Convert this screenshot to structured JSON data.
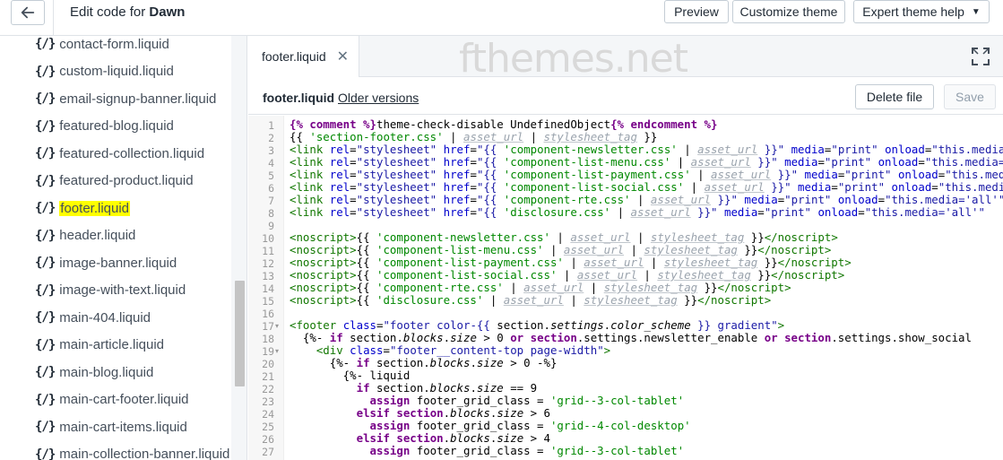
{
  "header": {
    "title_prefix": "Edit code for ",
    "theme_name": "Dawn",
    "preview_label": "Preview",
    "customize_label": "Customize theme",
    "expert_label": "Expert theme help"
  },
  "sidebar": {
    "icon_text": "{/}",
    "files": [
      "contact-form.liquid",
      "custom-liquid.liquid",
      "email-signup-banner.liquid",
      "featured-blog.liquid",
      "featured-collection.liquid",
      "featured-product.liquid",
      "footer.liquid",
      "header.liquid",
      "image-banner.liquid",
      "image-with-text.liquid",
      "main-404.liquid",
      "main-article.liquid",
      "main-blog.liquid",
      "main-cart-footer.liquid",
      "main-cart-items.liquid",
      "main-collection-banner.liquid"
    ],
    "active_index": 6
  },
  "editor": {
    "tab_label": "footer.liquid",
    "watermark": "fthemes.net",
    "file_name": "footer.liquid",
    "older_versions_label": "Older versions",
    "delete_label": "Delete file",
    "save_label": "Save",
    "line_numbers": [
      "1",
      "2",
      "3",
      "4",
      "5",
      "6",
      "7",
      "8",
      "9",
      "10",
      "11",
      "12",
      "13",
      "14",
      "15",
      "16",
      "17",
      "18",
      "19",
      "20",
      "21",
      "22",
      "23",
      "24",
      "25",
      "26",
      "27"
    ],
    "fold_lines": [
      17,
      19
    ],
    "code_lines": [
      [
        [
          "kw",
          "{% comment %}"
        ],
        [
          "t",
          "theme-check-disable UndefinedObject"
        ],
        [
          "kw",
          "{% endcomment %}"
        ]
      ],
      [
        [
          "t",
          "{{ "
        ],
        [
          "strg",
          "'section-footer.css'"
        ],
        [
          "t",
          " | "
        ],
        [
          "flt",
          "asset_url"
        ],
        [
          "t",
          " | "
        ],
        [
          "flt",
          "stylesheet_tag"
        ],
        [
          "t",
          " }}"
        ]
      ],
      [
        [
          "tag",
          "<link "
        ],
        [
          "attr",
          "rel"
        ],
        [
          "t",
          "="
        ],
        [
          "str",
          "\"stylesheet\""
        ],
        [
          "t",
          " "
        ],
        [
          "attr",
          "href"
        ],
        [
          "t",
          "="
        ],
        [
          "str",
          "\"{{ "
        ],
        [
          "strg",
          "'component-newsletter.css'"
        ],
        [
          "t",
          " | "
        ],
        [
          "flt",
          "asset_url"
        ],
        [
          "str",
          " }}\""
        ],
        [
          "t",
          " "
        ],
        [
          "attr",
          "media"
        ],
        [
          "t",
          "="
        ],
        [
          "str",
          "\"print\""
        ],
        [
          "t",
          " "
        ],
        [
          "attr",
          "onload"
        ],
        [
          "t",
          "="
        ],
        [
          "str",
          "\"this.media='all'\""
        ]
      ],
      [
        [
          "tag",
          "<link "
        ],
        [
          "attr",
          "rel"
        ],
        [
          "t",
          "="
        ],
        [
          "str",
          "\"stylesheet\""
        ],
        [
          "t",
          " "
        ],
        [
          "attr",
          "href"
        ],
        [
          "t",
          "="
        ],
        [
          "str",
          "\"{{ "
        ],
        [
          "strg",
          "'component-list-menu.css'"
        ],
        [
          "t",
          " | "
        ],
        [
          "flt",
          "asset_url"
        ],
        [
          "str",
          " }}\""
        ],
        [
          "t",
          " "
        ],
        [
          "attr",
          "media"
        ],
        [
          "t",
          "="
        ],
        [
          "str",
          "\"print\""
        ],
        [
          "t",
          " "
        ],
        [
          "attr",
          "onload"
        ],
        [
          "t",
          "="
        ],
        [
          "str",
          "\"this.media='all'\""
        ]
      ],
      [
        [
          "tag",
          "<link "
        ],
        [
          "attr",
          "rel"
        ],
        [
          "t",
          "="
        ],
        [
          "str",
          "\"stylesheet\""
        ],
        [
          "t",
          " "
        ],
        [
          "attr",
          "href"
        ],
        [
          "t",
          "="
        ],
        [
          "str",
          "\"{{ "
        ],
        [
          "strg",
          "'component-list-payment.css'"
        ],
        [
          "t",
          " | "
        ],
        [
          "flt",
          "asset_url"
        ],
        [
          "str",
          " }}\""
        ],
        [
          "t",
          " "
        ],
        [
          "attr",
          "media"
        ],
        [
          "t",
          "="
        ],
        [
          "str",
          "\"print\""
        ],
        [
          "t",
          " "
        ],
        [
          "attr",
          "onload"
        ],
        [
          "t",
          "="
        ],
        [
          "str",
          "\"this.media='all'\""
        ]
      ],
      [
        [
          "tag",
          "<link "
        ],
        [
          "attr",
          "rel"
        ],
        [
          "t",
          "="
        ],
        [
          "str",
          "\"stylesheet\""
        ],
        [
          "t",
          " "
        ],
        [
          "attr",
          "href"
        ],
        [
          "t",
          "="
        ],
        [
          "str",
          "\"{{ "
        ],
        [
          "strg",
          "'component-list-social.css'"
        ],
        [
          "t",
          " | "
        ],
        [
          "flt",
          "asset_url"
        ],
        [
          "str",
          " }}\""
        ],
        [
          "t",
          " "
        ],
        [
          "attr",
          "media"
        ],
        [
          "t",
          "="
        ],
        [
          "str",
          "\"print\""
        ],
        [
          "t",
          " "
        ],
        [
          "attr",
          "onload"
        ],
        [
          "t",
          "="
        ],
        [
          "str",
          "\"this.media='all'\""
        ]
      ],
      [
        [
          "tag",
          "<link "
        ],
        [
          "attr",
          "rel"
        ],
        [
          "t",
          "="
        ],
        [
          "str",
          "\"stylesheet\""
        ],
        [
          "t",
          " "
        ],
        [
          "attr",
          "href"
        ],
        [
          "t",
          "="
        ],
        [
          "str",
          "\"{{ "
        ],
        [
          "strg",
          "'component-rte.css'"
        ],
        [
          "t",
          " | "
        ],
        [
          "flt",
          "asset_url"
        ],
        [
          "str",
          " }}\""
        ],
        [
          "t",
          " "
        ],
        [
          "attr",
          "media"
        ],
        [
          "t",
          "="
        ],
        [
          "str",
          "\"print\""
        ],
        [
          "t",
          " "
        ],
        [
          "attr",
          "onload"
        ],
        [
          "t",
          "="
        ],
        [
          "str",
          "\"this.media='all'\""
        ]
      ],
      [
        [
          "tag",
          "<link "
        ],
        [
          "attr",
          "rel"
        ],
        [
          "t",
          "="
        ],
        [
          "str",
          "\"stylesheet\""
        ],
        [
          "t",
          " "
        ],
        [
          "attr",
          "href"
        ],
        [
          "t",
          "="
        ],
        [
          "str",
          "\"{{ "
        ],
        [
          "strg",
          "'disclosure.css'"
        ],
        [
          "t",
          " | "
        ],
        [
          "flt",
          "asset_url"
        ],
        [
          "str",
          " }}\""
        ],
        [
          "t",
          " "
        ],
        [
          "attr",
          "media"
        ],
        [
          "t",
          "="
        ],
        [
          "str",
          "\"print\""
        ],
        [
          "t",
          " "
        ],
        [
          "attr",
          "onload"
        ],
        [
          "t",
          "="
        ],
        [
          "str",
          "\"this.media='all'\""
        ]
      ],
      [],
      [
        [
          "tag",
          "<noscript>"
        ],
        [
          "t",
          "{{ "
        ],
        [
          "strg",
          "'component-newsletter.css'"
        ],
        [
          "t",
          " | "
        ],
        [
          "flt",
          "asset_url"
        ],
        [
          "t",
          " | "
        ],
        [
          "flt",
          "stylesheet_tag"
        ],
        [
          "t",
          " }}"
        ],
        [
          "tag",
          "</noscript>"
        ]
      ],
      [
        [
          "tag",
          "<noscript>"
        ],
        [
          "t",
          "{{ "
        ],
        [
          "strg",
          "'component-list-menu.css'"
        ],
        [
          "t",
          " | "
        ],
        [
          "flt",
          "asset_url"
        ],
        [
          "t",
          " | "
        ],
        [
          "flt",
          "stylesheet_tag"
        ],
        [
          "t",
          " }}"
        ],
        [
          "tag",
          "</noscript>"
        ]
      ],
      [
        [
          "tag",
          "<noscript>"
        ],
        [
          "t",
          "{{ "
        ],
        [
          "strg",
          "'component-list-payment.css'"
        ],
        [
          "t",
          " | "
        ],
        [
          "flt",
          "asset_url"
        ],
        [
          "t",
          " | "
        ],
        [
          "flt",
          "stylesheet_tag"
        ],
        [
          "t",
          " }}"
        ],
        [
          "tag",
          "</noscript>"
        ]
      ],
      [
        [
          "tag",
          "<noscript>"
        ],
        [
          "t",
          "{{ "
        ],
        [
          "strg",
          "'component-list-social.css'"
        ],
        [
          "t",
          " | "
        ],
        [
          "flt",
          "asset_url"
        ],
        [
          "t",
          " | "
        ],
        [
          "flt",
          "stylesheet_tag"
        ],
        [
          "t",
          " }}"
        ],
        [
          "tag",
          "</noscript>"
        ]
      ],
      [
        [
          "tag",
          "<noscript>"
        ],
        [
          "t",
          "{{ "
        ],
        [
          "strg",
          "'component-rte.css'"
        ],
        [
          "t",
          " | "
        ],
        [
          "flt",
          "asset_url"
        ],
        [
          "t",
          " | "
        ],
        [
          "flt",
          "stylesheet_tag"
        ],
        [
          "t",
          " }}"
        ],
        [
          "tag",
          "</noscript>"
        ]
      ],
      [
        [
          "tag",
          "<noscript>"
        ],
        [
          "t",
          "{{ "
        ],
        [
          "strg",
          "'disclosure.css'"
        ],
        [
          "t",
          " | "
        ],
        [
          "flt",
          "asset_url"
        ],
        [
          "t",
          " | "
        ],
        [
          "flt",
          "stylesheet_tag"
        ],
        [
          "t",
          " }}"
        ],
        [
          "tag",
          "</noscript>"
        ]
      ],
      [],
      [
        [
          "tag",
          "<footer "
        ],
        [
          "attr",
          "class"
        ],
        [
          "t",
          "="
        ],
        [
          "str",
          "\"footer color-{{ "
        ],
        [
          "t",
          "section."
        ],
        [
          "prop",
          "settings"
        ],
        [
          "t",
          "."
        ],
        [
          "prop",
          "color_scheme"
        ],
        [
          "str",
          " }} gradient\""
        ],
        [
          "tag",
          ">"
        ]
      ],
      [
        [
          "t",
          "  {%- "
        ],
        [
          "kw",
          "if"
        ],
        [
          "t",
          " section."
        ],
        [
          "prop",
          "blocks"
        ],
        [
          "t",
          "."
        ],
        [
          "prop",
          "size"
        ],
        [
          "t",
          " > 0 "
        ],
        [
          "kw",
          "or"
        ],
        [
          "t",
          " "
        ],
        [
          "kw",
          "section"
        ],
        [
          "t",
          ".settings.newsletter_enable "
        ],
        [
          "kw",
          "or"
        ],
        [
          "t",
          " "
        ],
        [
          "kw",
          "section"
        ],
        [
          "t",
          ".settings.show_social"
        ]
      ],
      [
        [
          "t",
          "    "
        ],
        [
          "tag",
          "<div "
        ],
        [
          "attr",
          "class"
        ],
        [
          "t",
          "="
        ],
        [
          "str",
          "\"footer__content-top page-width\""
        ],
        [
          "tag",
          ">"
        ]
      ],
      [
        [
          "t",
          "      {%- "
        ],
        [
          "kw",
          "if"
        ],
        [
          "t",
          " section."
        ],
        [
          "prop",
          "blocks"
        ],
        [
          "t",
          "."
        ],
        [
          "prop",
          "size"
        ],
        [
          "t",
          " > 0 -%}"
        ]
      ],
      [
        [
          "t",
          "        {%- liquid"
        ]
      ],
      [
        [
          "t",
          "          "
        ],
        [
          "kw",
          "if"
        ],
        [
          "t",
          " section."
        ],
        [
          "prop",
          "blocks"
        ],
        [
          "t",
          "."
        ],
        [
          "prop",
          "size"
        ],
        [
          "t",
          " == 9"
        ]
      ],
      [
        [
          "t",
          "            "
        ],
        [
          "kw",
          "assign"
        ],
        [
          "t",
          " footer_grid_class = "
        ],
        [
          "strg",
          "'grid--3-col-tablet'"
        ]
      ],
      [
        [
          "t",
          "          "
        ],
        [
          "kw",
          "elsif"
        ],
        [
          "t",
          " "
        ],
        [
          "kw",
          "section"
        ],
        [
          "t",
          "."
        ],
        [
          "prop",
          "blocks"
        ],
        [
          "t",
          "."
        ],
        [
          "prop",
          "size"
        ],
        [
          "t",
          " > 6"
        ]
      ],
      [
        [
          "t",
          "            "
        ],
        [
          "kw",
          "assign"
        ],
        [
          "t",
          " footer_grid_class = "
        ],
        [
          "strg",
          "'grid--4-col-desktop'"
        ]
      ],
      [
        [
          "t",
          "          "
        ],
        [
          "kw",
          "elsif"
        ],
        [
          "t",
          " "
        ],
        [
          "kw",
          "section"
        ],
        [
          "t",
          "."
        ],
        [
          "prop",
          "blocks"
        ],
        [
          "t",
          "."
        ],
        [
          "prop",
          "size"
        ],
        [
          "t",
          " > 4"
        ]
      ],
      [
        [
          "t",
          "            "
        ],
        [
          "kw",
          "assign"
        ],
        [
          "t",
          " footer_grid_class = "
        ],
        [
          "strg",
          "'grid--3-col-tablet'"
        ]
      ]
    ]
  },
  "colors": {
    "keyword": "#770088",
    "string": "#1a1aa6",
    "liquid_string": "#008800",
    "filter": "#9aa3ad",
    "tag": "#117700",
    "attribute": "#0000cc",
    "highlight": "#ffff00"
  },
  "icons": [
    "back-arrow-icon",
    "chevron-down-icon",
    "close-icon",
    "expand-icon",
    "liquid-file-icon"
  ]
}
